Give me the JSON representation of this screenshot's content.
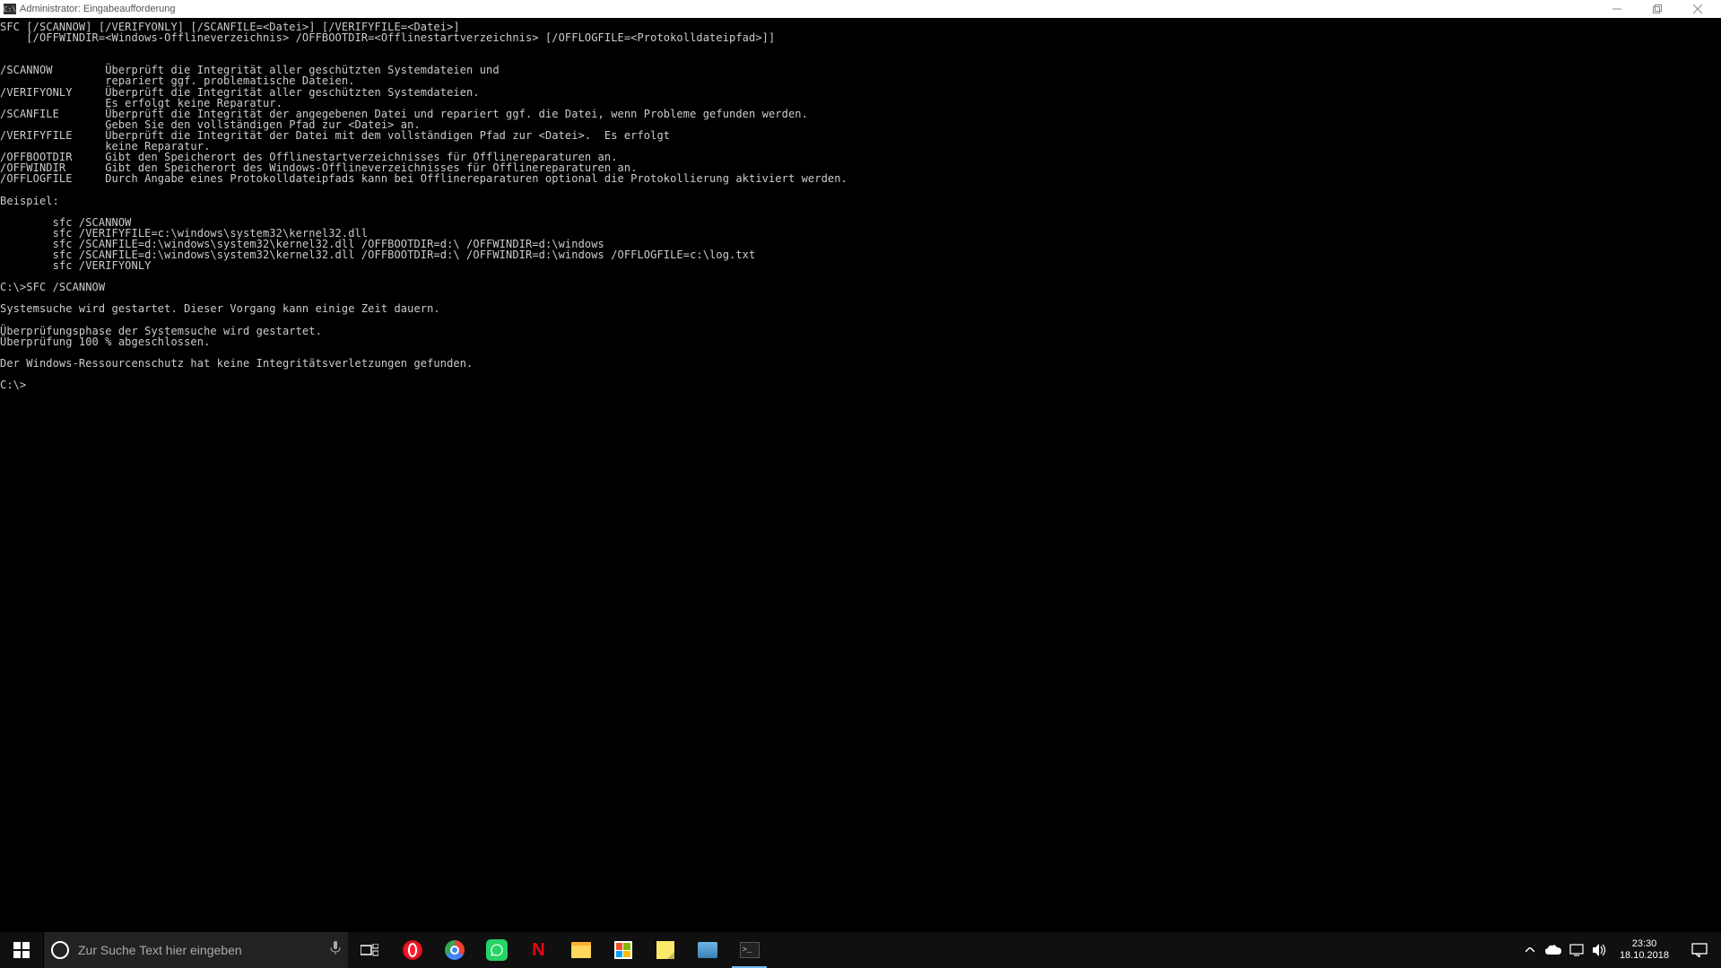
{
  "titlebar": {
    "icon_text": "C:\\",
    "title": "Administrator: Eingabeaufforderung"
  },
  "terminal": {
    "content": "SFC [/SCANNOW] [/VERIFYONLY] [/SCANFILE=<Datei>] [/VERIFYFILE=<Datei>]\n    [/OFFWINDIR=<Windows-Offlineverzeichnis> /OFFBOOTDIR=<Offlinestartverzeichnis> [/OFFLOGFILE=<Protokolldateipfad>]]\n\n\n/SCANNOW        Überprüft die Integrität aller geschützten Systemdateien und\n                repariert ggf. problematische Dateien.\n/VERIFYONLY     Überprüft die Integrität aller geschützten Systemdateien.\n                Es erfolgt keine Reparatur.\n/SCANFILE       Überprüft die Integrität der angegebenen Datei und repariert ggf. die Datei, wenn Probleme gefunden werden.\n                Geben Sie den vollständigen Pfad zur <Datei> an.\n/VERIFYFILE     Überprüft die Integrität der Datei mit dem vollständigen Pfad zur <Datei>.  Es erfolgt\n                keine Reparatur.\n/OFFBOOTDIR     Gibt den Speicherort des Offlinestartverzeichnisses für Offlinereparaturen an.\n/OFFWINDIR      Gibt den Speicherort des Windows-Offlineverzeichnisses für Offlinereparaturen an.\n/OFFLOGFILE     Durch Angabe eines Protokolldateipfads kann bei Offlinereparaturen optional die Protokollierung aktiviert werden.\n\nBeispiel:\n\n        sfc /SCANNOW\n        sfc /VERIFYFILE=c:\\windows\\system32\\kernel32.dll\n        sfc /SCANFILE=d:\\windows\\system32\\kernel32.dll /OFFBOOTDIR=d:\\ /OFFWINDIR=d:\\windows\n        sfc /SCANFILE=d:\\windows\\system32\\kernel32.dll /OFFBOOTDIR=d:\\ /OFFWINDIR=d:\\windows /OFFLOGFILE=c:\\log.txt\n        sfc /VERIFYONLY\n\nC:\\>SFC /SCANNOW\n\nSystemsuche wird gestartet. Dieser Vorgang kann einige Zeit dauern.\n\nÜberprüfungsphase der Systemsuche wird gestartet.\nÜberprüfung 100 % abgeschlossen.\n\nDer Windows-Ressourcenschutz hat keine Integritätsverletzungen gefunden.\n\nC:\\>"
  },
  "taskbar": {
    "search_placeholder": "Zur Suche Text hier eingeben",
    "time": "23:30",
    "date": "18.10.2018"
  }
}
